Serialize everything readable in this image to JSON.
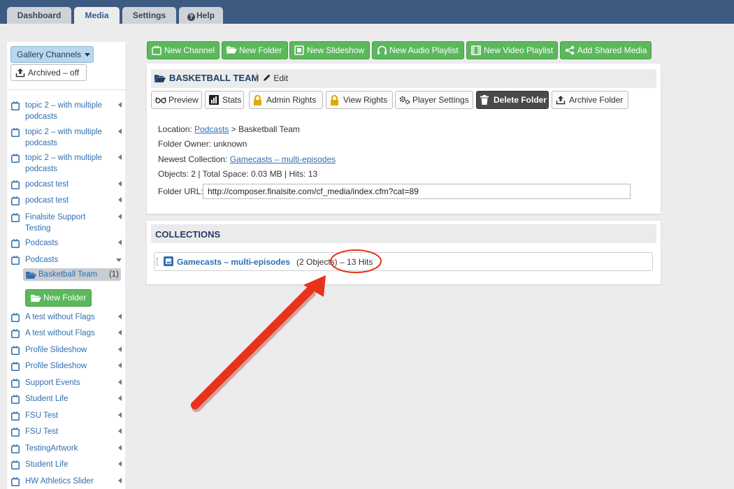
{
  "tabs": [
    "Dashboard",
    "Media",
    "Settings",
    "Help"
  ],
  "sidebar": {
    "gallery_label": "Gallery Channels",
    "archived_label": "Archived – off",
    "items": [
      {
        "label": "topic 2 – with multiple podcasts"
      },
      {
        "label": "topic 2 – with multiple podcasts"
      },
      {
        "label": "topic 2 – with multiple podcasts"
      },
      {
        "label": "podcast test"
      },
      {
        "label": "podcast test"
      },
      {
        "label": "Finalsite Support Testing"
      },
      {
        "label": "Podcasts"
      },
      {
        "label": "Podcasts"
      },
      {
        "label": "A test without Flags"
      },
      {
        "label": "A test without Flags"
      },
      {
        "label": "Profile Slideshow"
      },
      {
        "label": "Profile Slideshow"
      },
      {
        "label": "Support Events"
      },
      {
        "label": "Student Life"
      },
      {
        "label": "FSU Test"
      },
      {
        "label": "FSU Test"
      },
      {
        "label": "TestingArtwork"
      },
      {
        "label": "Student Life"
      },
      {
        "label": "HW Athletics Slider"
      }
    ],
    "subfolder": {
      "label": "Basketball Team",
      "count": "(1)"
    },
    "new_folder_label": "New Folder"
  },
  "toolbar": {
    "new_channel": "New Channel",
    "new_folder": "New Folder",
    "new_slideshow": "New Slideshow",
    "new_audio_playlist": "New Audio Playlist",
    "new_video_playlist": "New Video Playlist",
    "add_shared_media": "Add Shared Media"
  },
  "folder": {
    "title": "BASKETBALL TEAM",
    "edit_label": "Edit",
    "actions": {
      "preview": "Preview",
      "stats": "Stats",
      "admin_rights": "Admin Rights",
      "view_rights": "View Rights",
      "player_settings": "Player Settings",
      "delete_folder": "Delete Folder",
      "archive_folder": "Archive Folder"
    },
    "location_label": "Location:",
    "location_link": "Podcasts",
    "location_rest": "> Basketball Team",
    "owner": "Folder Owner: unknown",
    "newest_label": "Newest Collection:",
    "newest_link": "Gamecasts – multi-episodes",
    "stats_line": "Objects: 2 | Total Space: 0.03 MB | Hits: 13",
    "url_label": "Folder URL:",
    "url_value": "http://composer.finalsite.com/cf_media/index.cfm?cat=89"
  },
  "collections": {
    "heading": "COLLECTIONS",
    "items": [
      {
        "name": "Gamecasts – multi-episodes",
        "meta": "(2 Objects) – 13 Hits"
      }
    ]
  },
  "colors": {
    "topbar": "#3d5a80",
    "green_button": "#5cb85c",
    "link": "#2f6fb0",
    "annotation": "#e8321a"
  }
}
